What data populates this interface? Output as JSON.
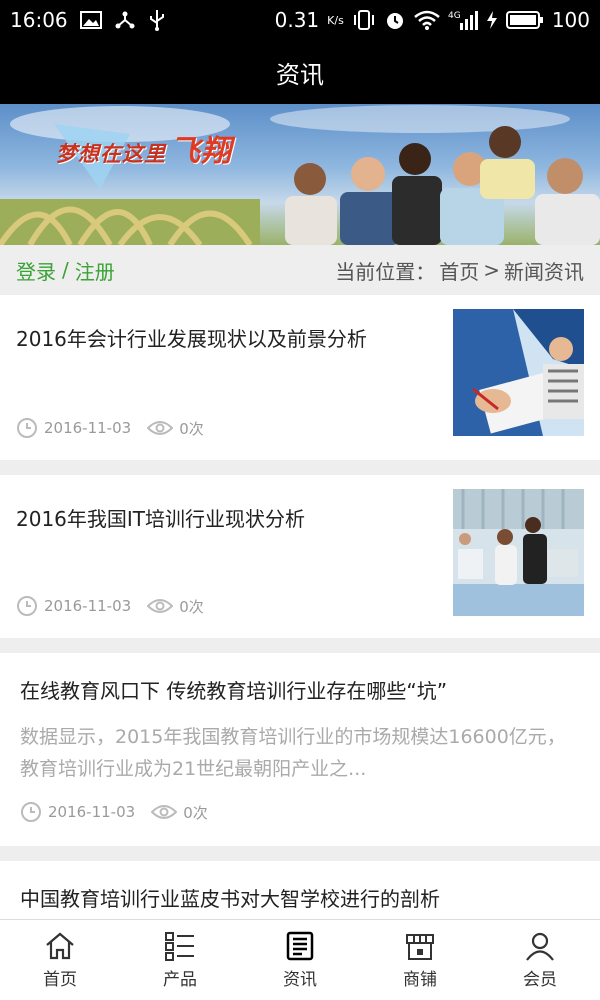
{
  "status_bar": {
    "time": "16:06",
    "speed": "0.31",
    "speed_unit": "K/s",
    "network": "4G",
    "battery": "100"
  },
  "header": {
    "title": "资讯"
  },
  "banner": {
    "slogan": "梦想在这里",
    "slogan_big": "飞翔"
  },
  "nav": {
    "login": "登录",
    "separator": "/",
    "register": "注册",
    "location_label": "当前位置：",
    "crumb_home": "首页",
    "crumb_sep": ">",
    "crumb_current": "新闻资讯"
  },
  "articles": [
    {
      "title": "2016年会计行业发展现状以及前景分析",
      "date": "2016-11-03",
      "views": "0次"
    },
    {
      "title": "2016年我国IT培训行业现状分析",
      "date": "2016-11-03",
      "views": "0次"
    },
    {
      "title": "在线教育风口下 传统教育培训行业存在哪些“坑”",
      "summary": "数据显示，2015年我国教育培训行业的市场规模达16600亿元，教育培训行业成为21世纪最朝阳产业之...",
      "date": "2016-11-03",
      "views": "0次"
    },
    {
      "title": "中国教育培训行业蓝皮书对大智学校进行的剖析"
    }
  ],
  "tabbar": {
    "items": [
      {
        "label": "首页",
        "icon": "home-icon"
      },
      {
        "label": "产品",
        "icon": "product-list-icon"
      },
      {
        "label": "资讯",
        "icon": "news-icon"
      },
      {
        "label": "商铺",
        "icon": "shop-icon"
      },
      {
        "label": "会员",
        "icon": "member-icon"
      }
    ],
    "active_color": "#000000",
    "inactive_color": "#333333"
  },
  "colors": {
    "accent_green": "#3aa335",
    "status_bar_bg": "#000000"
  }
}
